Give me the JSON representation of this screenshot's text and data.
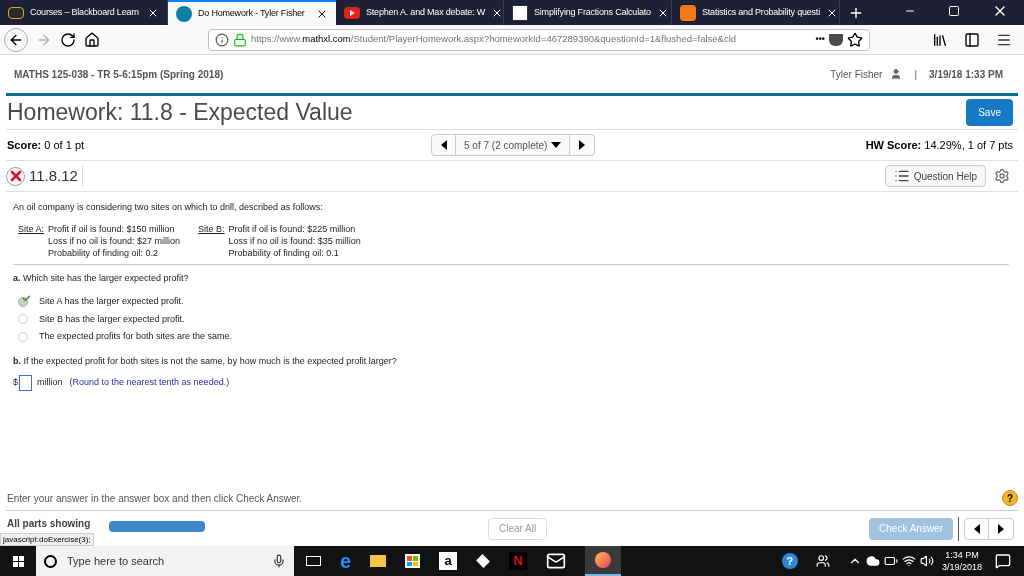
{
  "browser": {
    "tabs": [
      {
        "label": "Courses – Blackboard Learn",
        "selected": false
      },
      {
        "label": "Do Homework - Tyler Fisher",
        "selected": true
      },
      {
        "label": "Stephen A. and Max debate: W",
        "selected": false
      },
      {
        "label": "Simplifying Fractions Calculato",
        "selected": false
      },
      {
        "label": "Statistics and Probability questi",
        "selected": false
      }
    ],
    "url": {
      "prefix": "https://www.",
      "domain": "mathxl.com",
      "path": "/Student/PlayerHomework.aspx?homeworkId=467289390&questionId=1&flushed=false&cld"
    },
    "menu_dots": "•••"
  },
  "course": {
    "name": "MATHS 125-038 - TR 5-6:15pm (Spring 2018)",
    "user": "Tyler Fisher",
    "separator": "|",
    "datetime": "3/19/18 1:33 PM"
  },
  "homework": {
    "title": "Homework: 11.8 - Expected Value",
    "save": "Save"
  },
  "score": {
    "label": "Score:",
    "value": "0 of 1 pt",
    "nav": "5 of 7 (2 complete)",
    "hw_label": "HW Score:",
    "hw_value": "14.29%, 1 of 7 pts"
  },
  "question": {
    "number": "11.8.12",
    "help": "Question Help",
    "intro": "An oil company is considering two sites on which to drill, described as follows:",
    "sites": [
      {
        "name": "Site A:",
        "lines": [
          "Profit if oil is found: $150 million",
          "Loss if no oil is found: $27 million",
          "Probability of finding oil: 0.2"
        ]
      },
      {
        "name": "Site B:",
        "lines": [
          "Profit if oil is found: $225 million",
          "Loss if no oil is found: $35 million",
          "Probability of finding oil: 0.1"
        ]
      }
    ],
    "part_a": {
      "letter": "a.",
      "text": "Which site has the larger expected profit?",
      "options": [
        {
          "label": "Site A has the larger expected profit.",
          "selected": true
        },
        {
          "label": "Site B has the larger expected profit.",
          "selected": false
        },
        {
          "label": "The expected profits for both sites are the same.",
          "selected": false
        }
      ]
    },
    "part_b": {
      "letter": "b.",
      "text": "If the expected profit for both sites is not the same, by how much is the expected profit larger?",
      "prefix": "$",
      "unit": "million",
      "hint": "(Round to the nearest tenth as needed.)"
    }
  },
  "footer": {
    "instruction": "Enter your answer in the answer box and then click Check Answer.",
    "help": "?",
    "parts": "All parts showing",
    "clear": "Clear All",
    "check": "Check Answer",
    "status": "javascript:doExercise(3);"
  },
  "taskbar": {
    "search_placeholder": "Type here to search",
    "store_letter": "a",
    "edge_letter": "e",
    "help_tray": "?",
    "netflix_letter": "N",
    "time": "1:34 PM",
    "date": "3/19/2018"
  }
}
